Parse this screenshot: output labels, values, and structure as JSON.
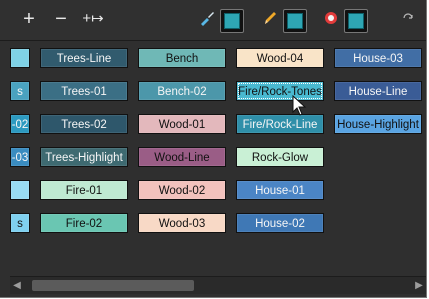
{
  "toolbar": {
    "add_icon": "+",
    "remove_icon": "−",
    "rename_icon": "+↦",
    "brush_icon": "brush-icon",
    "pencil_icon": "pencil-icon",
    "paint_icon": "paint-icon",
    "menu_icon": "refresh-icon",
    "swatch_color": "#2ea6b4"
  },
  "palette": {
    "rows": [
      [
        {
          "label": "",
          "bg": "#7fd2e6",
          "dark": true,
          "cut": true
        },
        {
          "label": "Trees-Line",
          "bg": "#315b6e",
          "dark": false
        },
        {
          "label": "Bench",
          "bg": "#6fb8b6",
          "dark": true
        },
        {
          "label": "Wood-04",
          "bg": "#f9e4c8",
          "dark": true
        },
        {
          "label": "House-03",
          "bg": "#416ea5",
          "dark": false
        }
      ],
      [
        {
          "label": "s",
          "bg": "#4aa2bf",
          "dark": false,
          "cut": true
        },
        {
          "label": "Trees-01",
          "bg": "#3b6f85",
          "dark": false
        },
        {
          "label": "Bench-02",
          "bg": "#4c97aa",
          "dark": false
        },
        {
          "label": "Fire/Rock-Tones",
          "bg": "#49b9d0",
          "dark": true,
          "selected": true
        },
        {
          "label": "House-Line",
          "bg": "#3a5c96",
          "dark": false
        }
      ],
      [
        {
          "label": "-02",
          "bg": "#2d9ac0",
          "dark": false,
          "cut": true
        },
        {
          "label": "Trees-02",
          "bg": "#2e576b",
          "dark": false
        },
        {
          "label": "Wood-01",
          "bg": "#e3b8bc",
          "dark": true
        },
        {
          "label": "Fire/Rock-Line",
          "bg": "#2f8fa9",
          "dark": false
        },
        {
          "label": "House-Highlight",
          "bg": "#5aa4e2",
          "dark": true
        }
      ],
      [
        {
          "label": "-03",
          "bg": "#3a8cc0",
          "dark": false,
          "cut": true
        },
        {
          "label": "Trees-Highlight",
          "bg": "#3e6a71",
          "dark": false
        },
        {
          "label": "Wood-Line",
          "bg": "#9a5d86",
          "dark": true
        },
        {
          "label": "Rock-Glow",
          "bg": "#c9f0d5",
          "dark": true
        }
      ],
      [
        {
          "label": "",
          "bg": "#99dcf3",
          "dark": true,
          "cut": true
        },
        {
          "label": "Fire-01",
          "bg": "#bfe9d2",
          "dark": true
        },
        {
          "label": "Wood-02",
          "bg": "#f2c2bd",
          "dark": true
        },
        {
          "label": "House-01",
          "bg": "#4b85c5",
          "dark": false
        }
      ],
      [
        {
          "label": "s",
          "bg": "#7fd0ef",
          "dark": true,
          "cut": true
        },
        {
          "label": "Fire-02",
          "bg": "#6ac6b2",
          "dark": true
        },
        {
          "label": "Wood-03",
          "bg": "#f8d9c6",
          "dark": true
        },
        {
          "label": "House-02",
          "bg": "#3f78b5",
          "dark": false
        }
      ]
    ]
  },
  "scrollbar": {
    "left_arrow": "◀",
    "right_arrow": "▶",
    "position": 0.2
  }
}
